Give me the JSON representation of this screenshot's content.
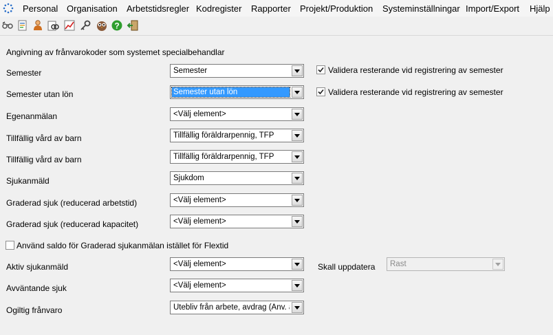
{
  "menu": [
    "Personal",
    "Organisation",
    "Arbetstidsregler",
    "Kodregister",
    "Rapporter",
    "Projekt/Produktion",
    "Systeminställningar",
    "Import/Export",
    "Hjälp"
  ],
  "toolbar_icons": [
    "handcuffs-icon",
    "document-icon",
    "person-icon",
    "binoculars-icon",
    "chart-icon",
    "key-icon",
    "owl-icon",
    "help-icon",
    "exit-icon"
  ],
  "section_title": "Angivning av frånvarokoder som systemet specialbehandlar",
  "rows": [
    {
      "label": "Semester",
      "value": "Semester"
    },
    {
      "label": "Semester utan lön",
      "value": "Semester utan lön"
    },
    {
      "label": "Egenanmälan",
      "value": "<Välj element>"
    },
    {
      "label": "Tillfällig vård av barn",
      "value": "Tillfällig föräldrarpennig, TFP"
    },
    {
      "label": "Tillfällig vård av barn",
      "value": "Tillfällig föräldrarpennig, TFP"
    },
    {
      "label": "Sjukanmäld",
      "value": "Sjukdom"
    },
    {
      "label": "Graderad sjuk (reducerad arbetstid)",
      "value": "<Välj element>"
    },
    {
      "label": "Graderad sjuk (reducerad kapacitet)",
      "value": "<Välj element>"
    },
    {
      "label": "Aktiv sjukanmäld",
      "value": "<Välj element>"
    },
    {
      "label": "Avväntande sjuk",
      "value": "<Välj element>"
    },
    {
      "label": "Ogiltig frånvaro",
      "value": "Utebliv från arbete, avdrag (Anv. av"
    }
  ],
  "validate_semester": {
    "label": "Validera resterande vid registrering av semester",
    "checked": true
  },
  "validate_semester_utan_lon": {
    "label": "Validera resterande vid registrering av semester",
    "checked": true
  },
  "use_saldo": {
    "label": "Använd saldo för Graderad sjukanmälan istället för Flextid",
    "checked": false
  },
  "skall_uppdatera": {
    "label": "Skall uppdatera",
    "value": "Rast"
  },
  "colors": {
    "selection": "#3399ff",
    "window_bg": "#f0f0f0"
  }
}
